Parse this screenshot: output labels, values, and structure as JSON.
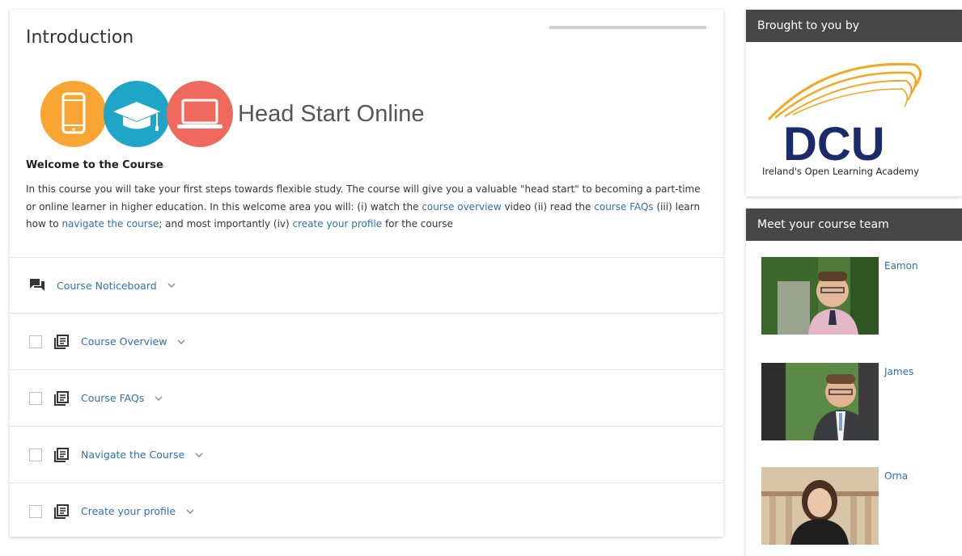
{
  "section": {
    "title": "Introduction",
    "banner_title": "Head Start Online",
    "welcome_title": "Welcome to the Course",
    "body": {
      "p1": "In this course you will take your first steps towards flexible study. The course will give you a valuable \"head start\" to becoming a part-time or online learner in higher education. In this welcome area you will: (i) watch the ",
      "link1": "course overview",
      "p2": " video (ii) read the ",
      "link2": "course FAQs",
      "p3": " (iii) learn how to ",
      "link3": "navigate the course",
      "p4": "; and most importantly (iv) ",
      "link4": "create your profile",
      "p5": " for the course"
    }
  },
  "activities": [
    {
      "label": "Course Noticeboard",
      "icon": "forum-icon",
      "checkbox": false
    },
    {
      "label": "Course Overview",
      "icon": "page-icon",
      "checkbox": true
    },
    {
      "label": "Course FAQs",
      "icon": "page-icon",
      "checkbox": true
    },
    {
      "label": "Navigate the Course",
      "icon": "page-icon",
      "checkbox": true
    },
    {
      "label": "Create your profile",
      "icon": "page-icon",
      "checkbox": true
    }
  ],
  "sidebar": {
    "brought_title": "Brought to you by",
    "logo_text": "DCU",
    "logo_subtitle": "Ireland's Open Learning Academy",
    "team_title": "Meet your course team",
    "team": [
      {
        "name": "Eamon"
      },
      {
        "name": "James"
      },
      {
        "name": "Orna"
      }
    ]
  },
  "colors": {
    "link": "#2f6fb7",
    "header_bg": "#474747",
    "circle_orange": "#f8a533",
    "circle_blue": "#1ea5c8",
    "circle_red": "#ef6a5c",
    "dcu_navy": "#1b2a6b",
    "dcu_gold": "#f5a623"
  }
}
